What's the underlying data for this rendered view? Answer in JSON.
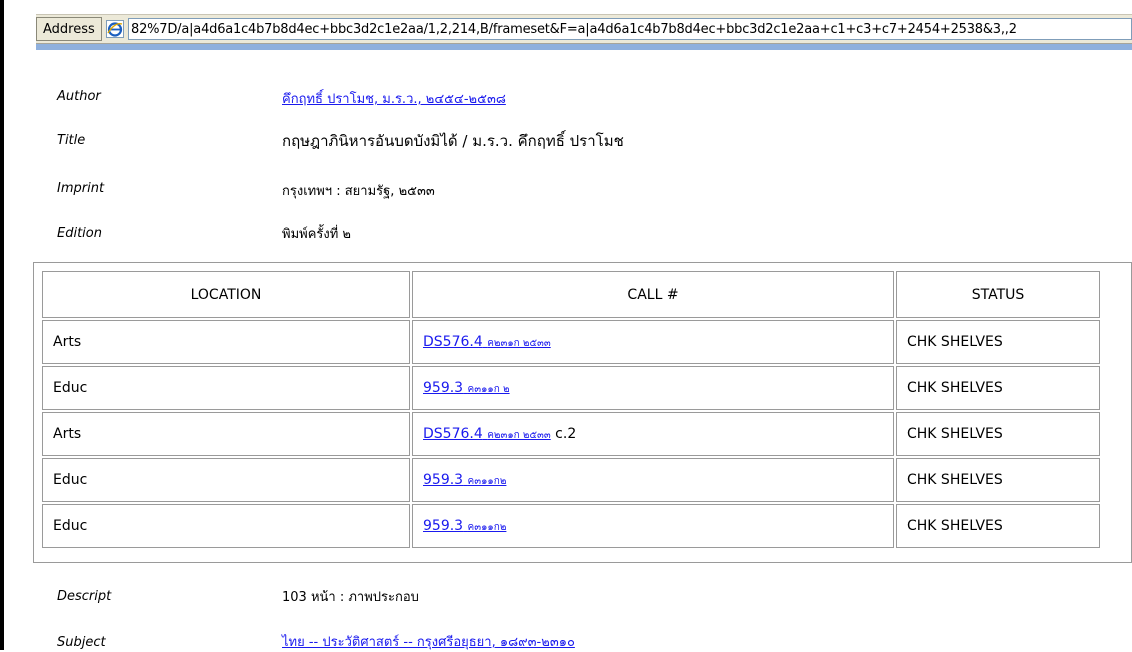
{
  "address_bar": {
    "label": "Address",
    "url": "82%7D/a|a4d6a1c4b7b8d4ec+bbc3d2c1e2aa/1,2,214,B/frameset&F=a|a4d6a1c4b7b8d4ec+bbc3d2c1e2aa+c1+c3+c7+2454+2538&3,,2"
  },
  "record": {
    "author": {
      "label": "Author",
      "value": "คึกฤทธิ์ ปราโมช, ม.ร.ว., ๒๔๕๔-๒๕๓๘"
    },
    "title": {
      "label": "Title",
      "value": "กฤษฎาภินิหารอันบดบังมิได้ / ม.ร.ว. คึกฤทธิ์ ปราโมช"
    },
    "imprint": {
      "label": "Imprint",
      "value": "กรุงเทพฯ : สยามรัฐ, ๒๕๓๓"
    },
    "edition": {
      "label": "Edition",
      "value": "พิมพ์ครั้งที่ ๒"
    },
    "descript": {
      "label": "Descript",
      "value": "103 หน้า : ภาพประกอบ"
    },
    "subject": {
      "label": "Subject",
      "value": "ไทย -- ประวัติศาสตร์ -- กรุงศรีอยุธยา, ๑๘๙๓-๒๓๑๐"
    }
  },
  "holdings": {
    "headers": [
      "LOCATION",
      "CALL #",
      "STATUS"
    ],
    "rows": [
      {
        "location": "Arts",
        "call_main": "DS576.4",
        "call_thai": "ค๒๓๑ก ๒๕๓๓",
        "call_suffix": "",
        "status": "CHK SHELVES"
      },
      {
        "location": "Educ",
        "call_main": "959.3",
        "call_thai": "ค๓๑๑ก ๒",
        "call_suffix": "",
        "status": "CHK SHELVES"
      },
      {
        "location": "Arts",
        "call_main": "DS576.4",
        "call_thai": "ค๒๓๑ก ๒๕๓๓",
        "call_suffix": " c.2",
        "status": "CHK SHELVES"
      },
      {
        "location": "Educ",
        "call_main": "959.3",
        "call_thai": "ค๓๑๑ก๒",
        "call_suffix": "",
        "status": "CHK SHELVES"
      },
      {
        "location": "Educ",
        "call_main": "959.3",
        "call_thai": "ค๓๑๑ก๒",
        "call_suffix": "",
        "status": "CHK SHELVES"
      }
    ]
  },
  "icons": {
    "address_icon": "internet-explorer-icon"
  }
}
